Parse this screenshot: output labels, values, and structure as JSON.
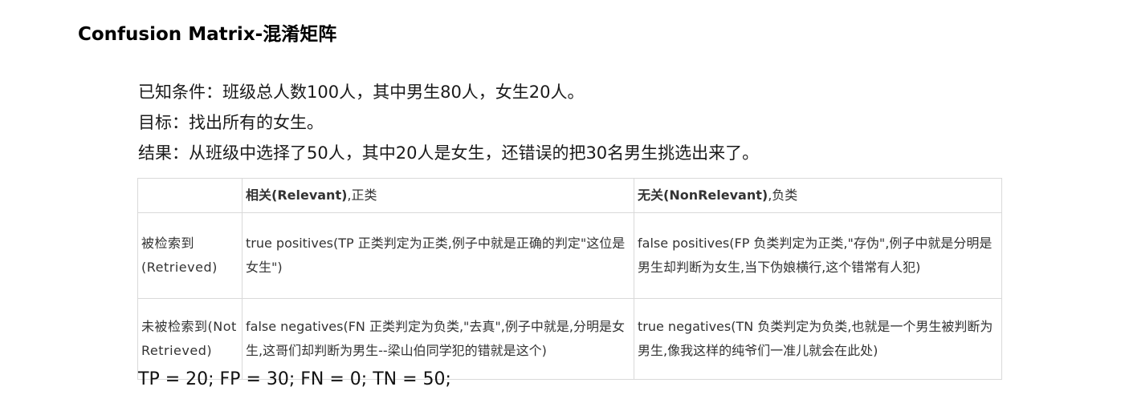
{
  "title": "Confusion Matrix-混淆矩阵",
  "intro": {
    "known": "已知条件：班级总人数100人，其中男生80人，女生20人。",
    "goal": "目标：找出所有的女生。",
    "result": "结果：从班级中选择了50人，其中20人是女生，还错误的把30名男生挑选出来了。"
  },
  "matrix": {
    "corner": "",
    "col_relevant_term": "相关(Relevant)",
    "col_relevant_suffix": ",正类",
    "col_nonrelevant_term": "无关(NonRelevant)",
    "col_nonrelevant_suffix": ",负类",
    "row_retrieved": "被检索到(Retrieved)",
    "row_not_retrieved": "未被检索到(Not Retrieved)",
    "tp": "true positives(TP 正类判定为正类,例子中就是正确的判定\"这位是女生\")",
    "fp": "false positives(FP 负类判定为正类,\"存伪\",例子中就是分明是男生却判断为女生,当下伪娘横行,这个错常有人犯)",
    "fn": "false negatives(FN 正类判定为负类,\"去真\",例子中就是,分明是女生,这哥们却判断为男生--梁山伯同学犯的错就是这个)",
    "tn": "true negatives(TN 负类判定为负类,也就是一个男生被判断为男生,像我这样的纯爷们一准儿就会在此处)"
  },
  "formula": "TP = 20; FP = 30; FN = 0; TN = 50;"
}
